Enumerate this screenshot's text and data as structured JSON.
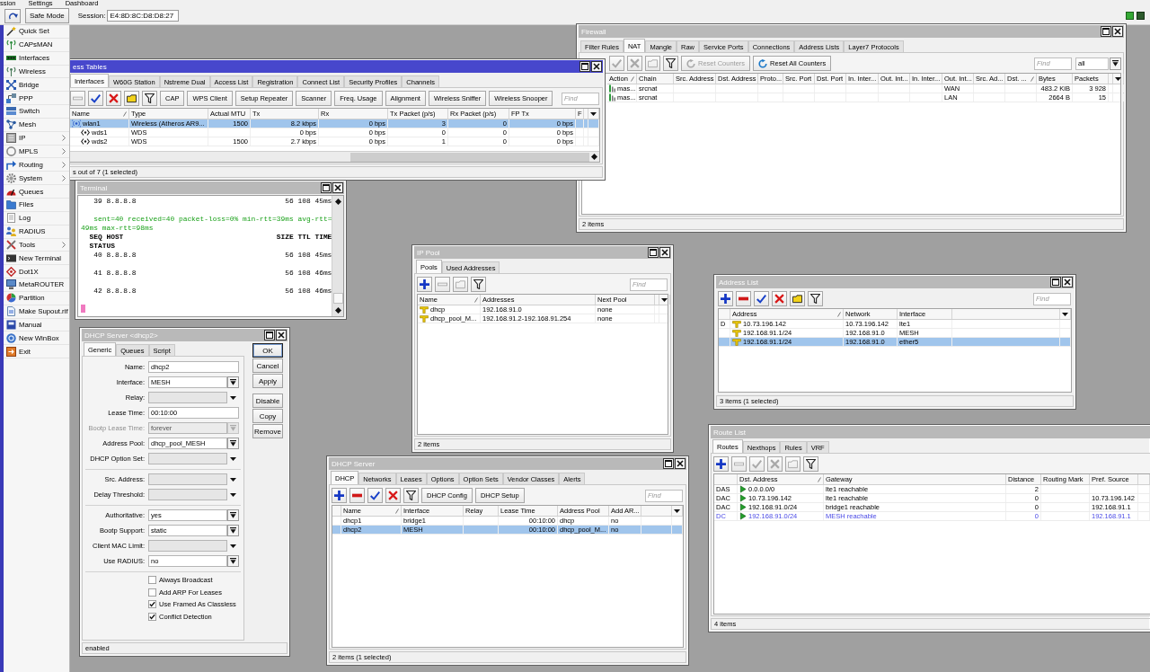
{
  "menu_bar": {
    "items": [
      "ssion",
      "Settings",
      "Dashboard"
    ]
  },
  "toolbar": {
    "safe_mode": "Safe Mode",
    "session_label": "Session:",
    "session_value": "E4:8D:8C:D8:D8:27"
  },
  "sidebar": {
    "items": [
      {
        "label": "Quick Set",
        "submenu": false
      },
      {
        "label": "CAPsMAN",
        "submenu": false
      },
      {
        "label": "Interfaces",
        "submenu": false
      },
      {
        "label": "Wireless",
        "submenu": false
      },
      {
        "label": "Bridge",
        "submenu": false
      },
      {
        "label": "PPP",
        "submenu": false
      },
      {
        "label": "Switch",
        "submenu": false
      },
      {
        "label": "Mesh",
        "submenu": false
      },
      {
        "label": "IP",
        "submenu": true
      },
      {
        "label": "MPLS",
        "submenu": true
      },
      {
        "label": "Routing",
        "submenu": true
      },
      {
        "label": "System",
        "submenu": true
      },
      {
        "label": "Queues",
        "submenu": false
      },
      {
        "label": "Files",
        "submenu": false
      },
      {
        "label": "Log",
        "submenu": false
      },
      {
        "label": "RADIUS",
        "submenu": false
      },
      {
        "label": "Tools",
        "submenu": true
      },
      {
        "label": "New Terminal",
        "submenu": false
      },
      {
        "label": "Dot1X",
        "submenu": false
      },
      {
        "label": "MetaROUTER",
        "submenu": false
      },
      {
        "label": "Partition",
        "submenu": false
      },
      {
        "label": "Make Supout.rif",
        "submenu": false
      },
      {
        "label": "Manual",
        "submenu": false
      },
      {
        "label": "New WinBox",
        "submenu": false
      },
      {
        "label": "Exit",
        "submenu": false
      }
    ]
  },
  "firewall": {
    "title": "Firewall",
    "active": false,
    "tabs": [
      {
        "label": "Filter Rules",
        "selected": false
      },
      {
        "label": "NAT",
        "selected": true
      },
      {
        "label": "Mangle",
        "selected": false
      },
      {
        "label": "Raw",
        "selected": false
      },
      {
        "label": "Service Ports",
        "selected": false
      },
      {
        "label": "Connections",
        "selected": false
      },
      {
        "label": "Address Lists",
        "selected": false
      },
      {
        "label": "Layer7 Protocols",
        "selected": false
      }
    ],
    "toolbar": [
      {
        "kind": "enable",
        "disabled": true
      },
      {
        "kind": "disable",
        "disabled": true
      },
      {
        "kind": "comment",
        "disabled": true
      },
      {
        "kind": "filter",
        "disabled": false
      },
      {
        "kind": "reset",
        "label": "Reset Counters",
        "disabled": true
      },
      {
        "kind": "reset",
        "label": "Reset All Counters",
        "disabled": false
      }
    ],
    "find": {
      "placeholder": "Find"
    },
    "filter_select": {
      "value": "all"
    },
    "table": {
      "columns": [
        {
          "label": "Action",
          "sorted": true
        },
        {
          "label": "Chain",
          "sorted": false
        },
        {
          "label": "Src. Address",
          "sorted": false
        },
        {
          "label": "Dst. Address",
          "sorted": false
        },
        {
          "label": "Proto...",
          "sorted": false
        },
        {
          "label": "Src. Port",
          "sorted": false
        },
        {
          "label": "Dst. Port",
          "sorted": false
        },
        {
          "label": "In. Inter...",
          "sorted": false
        },
        {
          "label": "Out. Int...",
          "sorted": false
        },
        {
          "label": "In. Inter...",
          "sorted": false
        },
        {
          "label": "Out. Int...",
          "sorted": false
        },
        {
          "label": "Src. Ad...",
          "sorted": false
        },
        {
          "label": "Dst. ...",
          "sorted": true
        },
        {
          "label": "Bytes",
          "sorted": false
        },
        {
          "label": "Packets",
          "sorted": false
        }
      ],
      "rows": [
        {
          "action": "mas...",
          "chain": "srcnat",
          "out_interface_list": "WAN",
          "bytes": "483.2 KiB",
          "packets": "3 928",
          "selected": false
        },
        {
          "action": "mas...",
          "chain": "srcnat",
          "out_interface_list": "LAN",
          "bytes": "2664 B",
          "packets": "15",
          "selected": false
        }
      ]
    },
    "status": "2 items"
  },
  "wireless_tables": {
    "title": "ess Tables",
    "active": true,
    "tabs": [
      {
        "label": "Interfaces",
        "selected": true
      },
      {
        "label": "W60G Station",
        "selected": false
      },
      {
        "label": "Nstreme Dual",
        "selected": false
      },
      {
        "label": "Access List",
        "selected": false
      },
      {
        "label": "Registration",
        "selected": false
      },
      {
        "label": "Connect List",
        "selected": false
      },
      {
        "label": "Security Profiles",
        "selected": false
      },
      {
        "label": "Channels",
        "selected": false
      }
    ],
    "toolbar": [
      {
        "kind": "remove",
        "disabled": true
      },
      {
        "kind": "enable",
        "disabled": false
      },
      {
        "kind": "disable",
        "disabled": false
      },
      {
        "kind": "comment",
        "disabled": false
      },
      {
        "kind": "filter",
        "disabled": false
      },
      {
        "kind": "text",
        "label": "CAP",
        "disabled": false
      },
      {
        "kind": "text",
        "label": "WPS Client",
        "disabled": false
      },
      {
        "kind": "text",
        "label": "Setup Repeater",
        "disabled": false
      },
      {
        "kind": "text",
        "label": "Scanner",
        "disabled": false
      },
      {
        "kind": "text",
        "label": "Freq. Usage",
        "disabled": false
      },
      {
        "kind": "text",
        "label": "Alignment",
        "disabled": false
      },
      {
        "kind": "text",
        "label": "Wireless Sniffer",
        "disabled": false
      },
      {
        "kind": "text",
        "label": "Wireless Snooper",
        "disabled": false
      }
    ],
    "find": {
      "placeholder": "Find"
    },
    "table": {
      "columns": [
        {
          "label": "Name",
          "sorted": true
        },
        {
          "label": "Type",
          "sorted": false
        },
        {
          "label": "Actual MTU",
          "sorted": false
        },
        {
          "label": "Tx",
          "sorted": false
        },
        {
          "label": "Rx",
          "sorted": false
        },
        {
          "label": "Tx Packet (p/s)",
          "sorted": false
        },
        {
          "label": "Rx Packet (p/s)",
          "sorted": false
        },
        {
          "label": "FP Tx",
          "sorted": false
        },
        {
          "label": "F",
          "sorted": false
        }
      ],
      "rows": [
        {
          "kind": "wireless",
          "name": "wlan1",
          "type": "Wireless (Atheros AR9...",
          "actual_mtu": "1500",
          "tx": "8.2 kbps",
          "rx": "0 bps",
          "tx_packet": "3",
          "rx_packet": "0",
          "fp_tx": "0 bps",
          "selected": true,
          "children": [
            {
              "kind": "wds",
              "name": "wds1",
              "type": "WDS",
              "tx": "0 bps",
              "rx": "0 bps",
              "tx_packet": "0",
              "rx_packet": "0",
              "fp_tx": "0 bps",
              "selected": false
            },
            {
              "kind": "wds",
              "name": "wds2",
              "type": "WDS",
              "actual_mtu": "1500",
              "tx": "2.7 kbps",
              "rx": "0 bps",
              "tx_packet": "1",
              "rx_packet": "0",
              "fp_tx": "0 bps",
              "selected": false
            }
          ]
        }
      ]
    },
    "status": "s out of 7 (1 selected)"
  },
  "terminal": {
    "title": "Terminal",
    "active": false,
    "lines": [
      {
        "kind": "reply",
        "seq_host": "39 8.8.8.8",
        "size_ttl_time": "56 108 45ms"
      },
      {
        "kind": "summary",
        "text": "sent=40 received=40 packet-loss=0% min-rtt=39ms avg-rtt=49ms max-rtt=98ms"
      },
      {
        "kind": "header",
        "seq_host": "SEQ HOST",
        "size_ttl_time": "SIZE TTL TIME",
        "status": "STATUS"
      },
      {
        "kind": "reply",
        "seq_host": "40 8.8.8.8",
        "size_ttl_time": "56 108 45ms"
      },
      {
        "kind": "reply",
        "seq_host": "41 8.8.8.8",
        "size_ttl_time": "56 108 46ms"
      },
      {
        "kind": "reply",
        "seq_host": "42 8.8.8.8",
        "size_ttl_time": "56 108 46ms"
      }
    ],
    "cursor": true
  },
  "ip_pool": {
    "title": "IP Pool",
    "active": false,
    "tabs": [
      {
        "label": "Pools",
        "selected": true
      },
      {
        "label": "Used Addresses",
        "selected": false
      }
    ],
    "toolbar": [
      {
        "kind": "add",
        "disabled": false
      },
      {
        "kind": "remove",
        "disabled": true
      },
      {
        "kind": "comment",
        "disabled": true
      },
      {
        "kind": "filter",
        "disabled": false
      }
    ],
    "find": {
      "placeholder": "Find"
    },
    "table": {
      "columns": [
        {
          "label": "Name",
          "sorted": true
        },
        {
          "label": "Addresses",
          "sorted": false
        },
        {
          "label": "Next Pool",
          "sorted": false
        }
      ],
      "rows": [
        {
          "name": "dhcp",
          "addresses": "192.168.91.0",
          "next_pool": "none",
          "selected": false
        },
        {
          "name": "dhcp_pool_M...",
          "addresses": "192.168.91.2-192.168.91.254",
          "next_pool": "none",
          "selected": false
        }
      ]
    },
    "status": "2 items"
  },
  "address_list": {
    "title": "Address List",
    "active": false,
    "toolbar": [
      {
        "kind": "add",
        "disabled": false
      },
      {
        "kind": "remove",
        "disabled": false
      },
      {
        "kind": "enable",
        "disabled": false
      },
      {
        "kind": "disable",
        "disabled": false
      },
      {
        "kind": "comment",
        "disabled": false
      },
      {
        "kind": "filter",
        "disabled": false
      }
    ],
    "find": {
      "placeholder": "Find"
    },
    "table": {
      "columns": [
        {
          "label": "Address",
          "sorted": true
        },
        {
          "label": "Network",
          "sorted": false
        },
        {
          "label": "Interface",
          "sorted": false
        }
      ],
      "rows": [
        {
          "flags": "D",
          "address": "10.73.196.142",
          "network": "10.73.196.142",
          "interface": "lte1",
          "selected": false
        },
        {
          "address": "192.168.91.1/24",
          "network": "192.168.91.0",
          "interface": "MESH",
          "selected": false
        },
        {
          "address": "192.168.91.1/24",
          "network": "192.168.91.0",
          "interface": "ether5",
          "selected": true
        }
      ]
    },
    "status": "3 items (1 selected)"
  },
  "dhcp_server_dialog": {
    "title": "DHCP Server <dhcp2>",
    "active": false,
    "tabs": [
      {
        "label": "Generic",
        "selected": true
      },
      {
        "label": "Queues",
        "selected": false
      },
      {
        "label": "Script",
        "selected": false
      }
    ],
    "sections": [
      {
        "fields": [
          {
            "kind": "text",
            "label": "Name:",
            "value": "dhcp2",
            "disabled": false
          },
          {
            "kind": "select",
            "label": "Interface:",
            "value": "MESH",
            "disabled": false
          },
          {
            "kind": "optional",
            "label": "Relay:",
            "disabled": false
          },
          {
            "kind": "text",
            "label": "Lease Time:",
            "value": "00:10:00",
            "disabled": false
          },
          {
            "kind": "select",
            "label": "Bootp Lease Time:",
            "value": "forever",
            "disabled": true
          },
          {
            "kind": "select",
            "label": "Address Pool:",
            "value": "dhcp_pool_MESH",
            "disabled": false
          },
          {
            "kind": "optional",
            "label": "DHCP Option Set:",
            "disabled": false
          }
        ]
      },
      {
        "fields": [
          {
            "kind": "optional",
            "label": "Src. Address:",
            "disabled": false
          },
          {
            "kind": "optional",
            "label": "Delay Threshold:",
            "disabled": false
          }
        ]
      },
      {
        "fields": [
          {
            "kind": "select",
            "label": "Authoritative:",
            "value": "yes",
            "disabled": false
          },
          {
            "kind": "select",
            "label": "Bootp Support:",
            "value": "static",
            "disabled": false
          },
          {
            "kind": "optional",
            "label": "Client MAC Limit:",
            "disabled": false
          },
          {
            "kind": "select",
            "label": "Use RADIUS:",
            "value": "no",
            "disabled": false
          }
        ]
      }
    ],
    "checkboxes": [
      {
        "label": "Always Broadcast",
        "checked": false
      },
      {
        "label": "Add ARP For Leases",
        "checked": false
      },
      {
        "label": "Use Framed As Classless",
        "checked": true
      },
      {
        "label": "Conflict Detection",
        "checked": true
      }
    ],
    "button_groups": [
      {
        "buttons": [
          {
            "label": "OK",
            "default": true
          },
          {
            "label": "Cancel",
            "default": false
          },
          {
            "label": "Apply",
            "default": false
          }
        ]
      },
      {
        "buttons": [
          {
            "label": "Disable",
            "default": false
          },
          {
            "label": "Copy",
            "default": false
          },
          {
            "label": "Remove",
            "default": false
          }
        ]
      }
    ],
    "status": "enabled"
  },
  "dhcp_server": {
    "title": "DHCP Server",
    "active": false,
    "tabs": [
      {
        "label": "DHCP",
        "selected": true
      },
      {
        "label": "Networks",
        "selected": false
      },
      {
        "label": "Leases",
        "selected": false
      },
      {
        "label": "Options",
        "selected": false
      },
      {
        "label": "Option Sets",
        "selected": false
      },
      {
        "label": "Vendor Classes",
        "selected": false
      },
      {
        "label": "Alerts",
        "selected": false
      }
    ],
    "toolbar": [
      {
        "kind": "add",
        "disabled": false
      },
      {
        "kind": "remove",
        "disabled": false
      },
      {
        "kind": "enable",
        "disabled": false
      },
      {
        "kind": "disable",
        "disabled": false
      },
      {
        "kind": "filter",
        "disabled": false
      },
      {
        "kind": "text",
        "label": "DHCP Config",
        "disabled": false
      },
      {
        "kind": "text",
        "label": "DHCP Setup",
        "disabled": false
      }
    ],
    "find": {
      "placeholder": "Find"
    },
    "table": {
      "columns": [
        {
          "label": "Name",
          "sorted": true
        },
        {
          "label": "Interface",
          "sorted": false
        },
        {
          "label": "Relay",
          "sorted": false
        },
        {
          "label": "Lease Time",
          "sorted": false
        },
        {
          "label": "Address Pool",
          "sorted": false
        },
        {
          "label": "Add AR...",
          "sorted": false
        }
      ],
      "rows": [
        {
          "name": "dhcp1",
          "interface": "bridge1",
          "lease_time": "00:10:00",
          "address_pool": "dhcp",
          "add_arp": "no",
          "selected": false
        },
        {
          "name": "dhcp2",
          "interface": "MESH",
          "lease_time": "00:10:00",
          "address_pool": "dhcp_pool_M...",
          "add_arp": "no",
          "selected": true
        }
      ]
    },
    "status": "2 items (1 selected)"
  },
  "route_list": {
    "title": "Route List",
    "active": false,
    "tabs": [
      {
        "label": "Routes",
        "selected": true
      },
      {
        "label": "Nexthops",
        "selected": false
      },
      {
        "label": "Rules",
        "selected": false
      },
      {
        "label": "VRF",
        "selected": false
      }
    ],
    "toolbar": [
      {
        "kind": "add",
        "disabled": false
      },
      {
        "kind": "remove",
        "disabled": true
      },
      {
        "kind": "enable",
        "disabled": true
      },
      {
        "kind": "disable",
        "disabled": true
      },
      {
        "kind": "comment",
        "disabled": true
      },
      {
        "kind": "filter",
        "disabled": false
      }
    ],
    "table": {
      "columns": [
        {
          "label": "Dst. Address",
          "sorted": true
        },
        {
          "label": "Gateway",
          "sorted": false
        },
        {
          "label": "Distance",
          "sorted": false
        },
        {
          "label": "Routing Mark",
          "sorted": false
        },
        {
          "label": "Pref. Source",
          "sorted": false
        }
      ],
      "rows": [
        {
          "flags": "DAS",
          "dst_address": "0.0.0.0/0",
          "gateway": "lte1 reachable",
          "distance": "2",
          "active": true,
          "selected": false
        },
        {
          "flags": "DAC",
          "dst_address": "10.73.196.142",
          "gateway": "lte1 reachable",
          "distance": "0",
          "pref_source": "10.73.196.142",
          "active": true,
          "selected": false
        },
        {
          "flags": "DAC",
          "dst_address": "192.168.91.0/24",
          "gateway": "bridge1 reachable",
          "distance": "0",
          "pref_source": "192.168.91.1",
          "active": true,
          "selected": false
        },
        {
          "flags": "DC",
          "dst_address": "192.168.91.0/24",
          "gateway": "MESH reachable",
          "distance": "0",
          "pref_source": "192.168.91.1",
          "active": false,
          "selected": false
        }
      ]
    },
    "status": "4 items"
  }
}
